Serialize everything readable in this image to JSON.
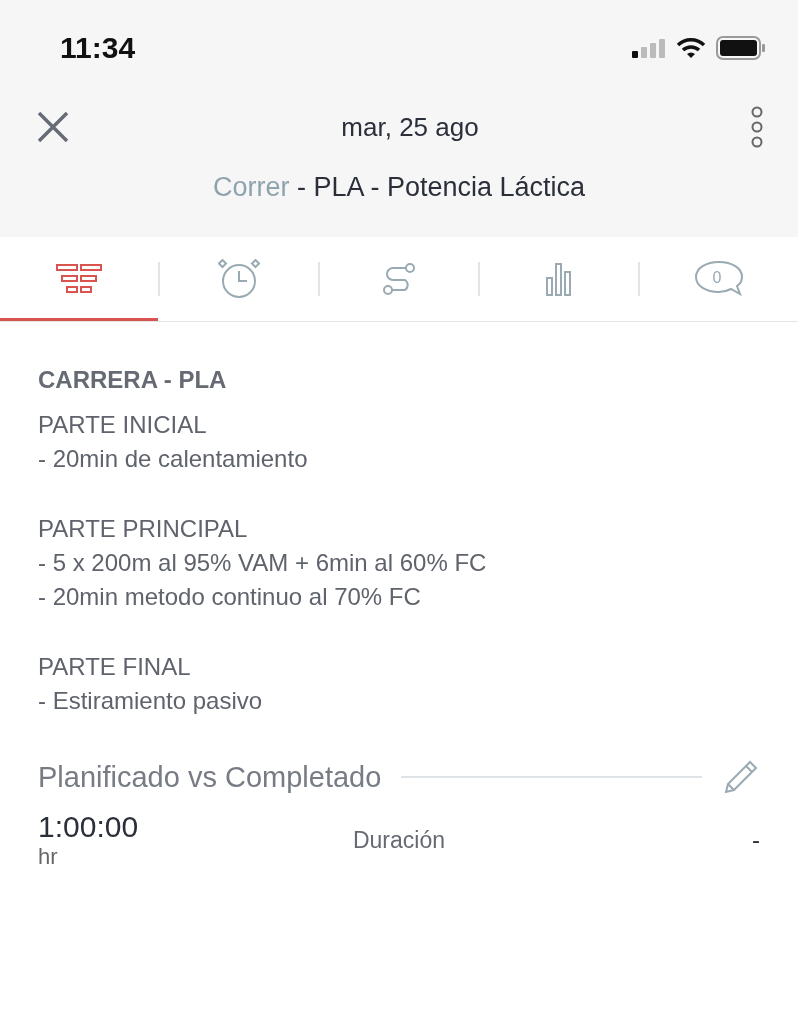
{
  "status_bar": {
    "time": "11:34"
  },
  "header": {
    "date": "mar, 25 ago",
    "sport": "Correr",
    "title": " - PLA - Potencia Láctica"
  },
  "tabs": [
    {
      "kind": "list",
      "selected": true
    },
    {
      "kind": "alarm",
      "selected": false
    },
    {
      "kind": "route",
      "selected": false
    },
    {
      "kind": "bars",
      "selected": false
    },
    {
      "kind": "comments",
      "count": "0",
      "selected": false
    }
  ],
  "description": {
    "title": "CARRERA - PLA",
    "sections": [
      {
        "heading": "PARTE INICIAL",
        "lines": [
          "- 20min de calentamiento"
        ]
      },
      {
        "heading": "PARTE PRINCIPAL",
        "lines": [
          "- 5 x 200m al 95% VAM + 6min al 60% FC",
          "- 20min metodo continuo al 70% FC"
        ]
      },
      {
        "heading": "PARTE FINAL",
        "lines": [
          "- Estiramiento pasivo"
        ]
      }
    ]
  },
  "comparison": {
    "title": "Planificado vs Completado",
    "planned_value": "1:00:00",
    "planned_unit": "hr",
    "metric": "Duración",
    "completed_value": "-"
  }
}
